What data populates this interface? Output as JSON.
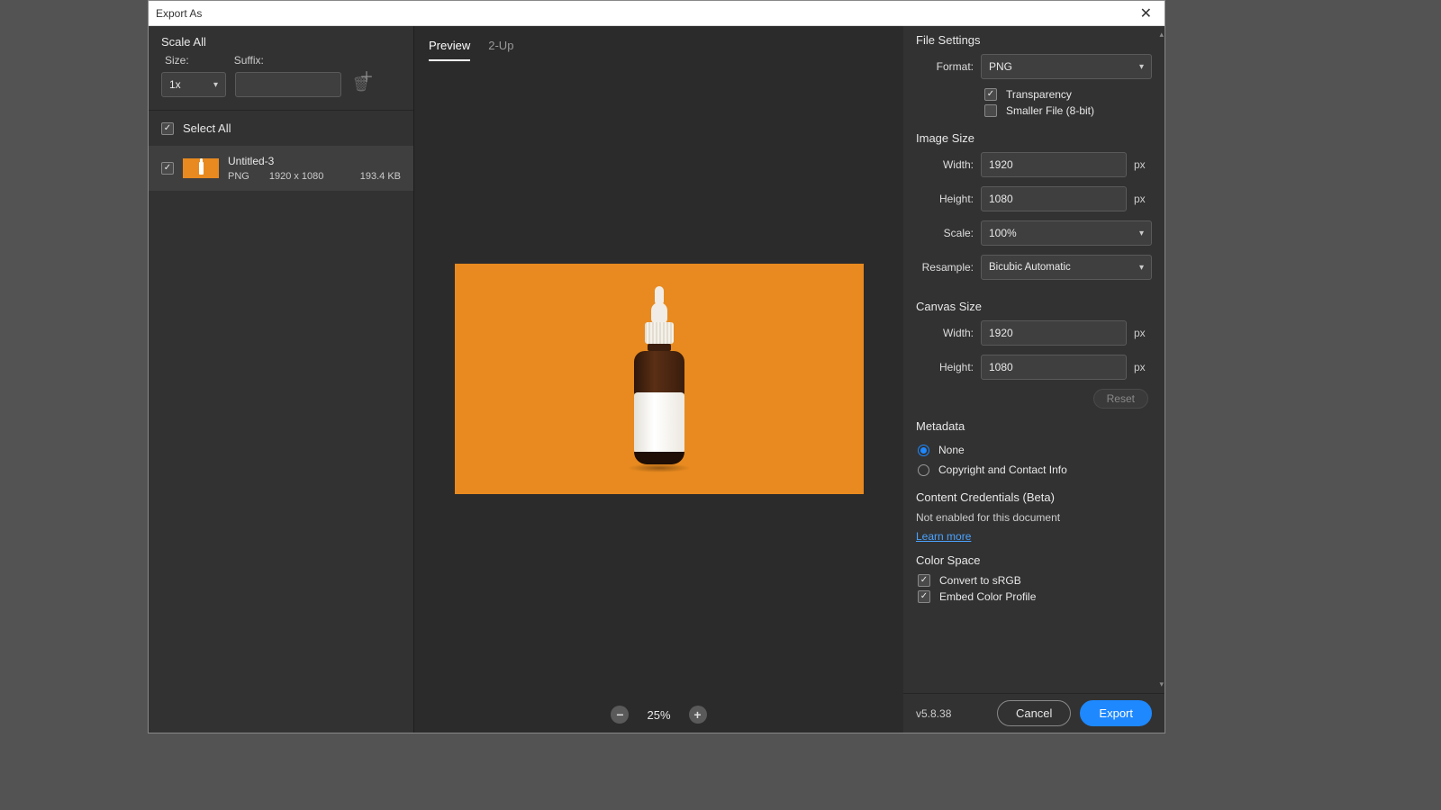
{
  "window": {
    "title": "Export As"
  },
  "left": {
    "scale_all_title": "Scale All",
    "size_label": "Size:",
    "suffix_label": "Suffix:",
    "size_value": "1x",
    "suffix_value": "",
    "select_all_label": "Select All",
    "asset": {
      "name": "Untitled-3",
      "format": "PNG",
      "dimensions": "1920 x 1080",
      "filesize": "193.4 KB"
    }
  },
  "center": {
    "tabs": {
      "preview": "Preview",
      "two_up": "2-Up"
    },
    "zoom": "25%"
  },
  "right": {
    "file_settings": {
      "title": "File Settings",
      "format_label": "Format:",
      "format_value": "PNG",
      "transparency_label": "Transparency",
      "smaller_file_label": "Smaller File (8-bit)"
    },
    "image_size": {
      "title": "Image Size",
      "width_label": "Width:",
      "width_value": "1920",
      "height_label": "Height:",
      "height_value": "1080",
      "scale_label": "Scale:",
      "scale_value": "100%",
      "resample_label": "Resample:",
      "resample_value": "Bicubic Automatic",
      "px": "px"
    },
    "canvas_size": {
      "title": "Canvas Size",
      "width_label": "Width:",
      "width_value": "1920",
      "height_label": "Height:",
      "height_value": "1080",
      "px": "px",
      "reset": "Reset"
    },
    "metadata": {
      "title": "Metadata",
      "none": "None",
      "copyright": "Copyright and Contact Info"
    },
    "credentials": {
      "title": "Content Credentials (Beta)",
      "status": "Not enabled for this document",
      "learn": "Learn more"
    },
    "color_space": {
      "title": "Color Space",
      "convert": "Convert to sRGB",
      "embed": "Embed Color Profile"
    }
  },
  "footer": {
    "version": "v5.8.38",
    "cancel": "Cancel",
    "export": "Export"
  }
}
